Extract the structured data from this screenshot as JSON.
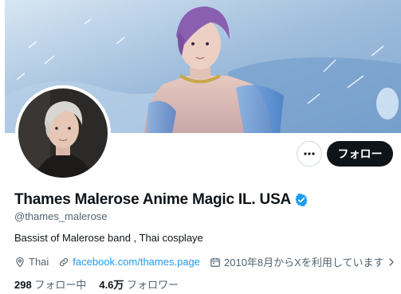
{
  "profile": {
    "display_name": "Thames Malerose Anime Magic IL. USA",
    "handle": "@thames_malerose",
    "verified": true,
    "bio": "Bassist of Malerose band , Thai cosplaye",
    "location": "Thai",
    "website": "facebook.com/thames.page",
    "joined": "2010年8月からXを利用しています",
    "following_count": "298",
    "following_label": "フォロー中",
    "followers_count": "4.6万",
    "followers_label": "フォロワー"
  },
  "actions": {
    "follow_label": "フォロー",
    "more_label": "more"
  },
  "icons": {
    "verified": "verified-badge-icon",
    "location": "location-pin-icon",
    "website": "link-icon",
    "joined": "calendar-icon",
    "joined_more": "chevron-right-icon",
    "more": "more-dots-icon"
  },
  "colors": {
    "accent": "#1d9bf0",
    "follow_button_bg": "#0f1419",
    "muted_text": "#536471"
  }
}
